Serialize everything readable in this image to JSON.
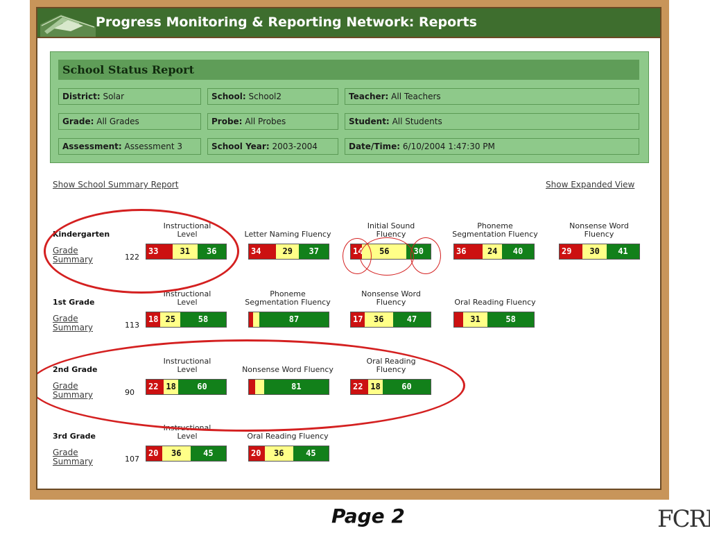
{
  "app_title": "Progress Monitoring & Reporting Network: Reports",
  "report": {
    "title": "School Status Report",
    "fields": {
      "district": {
        "label": "District:",
        "value": "Solar"
      },
      "school": {
        "label": "School:",
        "value": "School2"
      },
      "teacher": {
        "label": "Teacher:",
        "value": "All Teachers"
      },
      "grade": {
        "label": "Grade:",
        "value": "All Grades"
      },
      "probe": {
        "label": "Probe:",
        "value": "All Probes"
      },
      "student": {
        "label": "Student:",
        "value": "All Students"
      },
      "assessment": {
        "label": "Assessment:",
        "value": "Assessment 3"
      },
      "school_year": {
        "label": "School Year:",
        "value": "2003-2004"
      },
      "datetime": {
        "label": "Date/Time:",
        "value": "6/10/2004 1:47:30 PM"
      }
    }
  },
  "links": {
    "school_summary": "Show School Summary Report",
    "expanded_view": "Show Expanded View"
  },
  "grade_summary_label": [
    "Grade",
    "Summary"
  ],
  "grades": [
    {
      "name": "Kindergarten",
      "count": "122",
      "measures": [
        {
          "title": [
            "Instructional",
            "Level"
          ],
          "values": [
            33,
            31,
            36
          ],
          "labels": [
            "33",
            "31",
            "36"
          ]
        },
        {
          "title": [
            "Letter Naming Fluency"
          ],
          "values": [
            34,
            29,
            37
          ],
          "labels": [
            "34",
            "29",
            "37"
          ]
        },
        {
          "title": [
            "Initial Sound",
            "Fluency"
          ],
          "values": [
            14,
            56,
            30
          ],
          "labels": [
            "14",
            "56",
            "30"
          ]
        },
        {
          "title": [
            "Phoneme",
            "Segmentation Fluency"
          ],
          "values": [
            36,
            24,
            40
          ],
          "labels": [
            "36",
            "24",
            "40"
          ]
        },
        {
          "title": [
            "Nonsense Word",
            "Fluency"
          ],
          "values": [
            29,
            30,
            41
          ],
          "labels": [
            "29",
            "30",
            "41"
          ]
        }
      ]
    },
    {
      "name": "1st Grade",
      "count": "113",
      "measures": [
        {
          "title": [
            "Instructional",
            "Level"
          ],
          "values": [
            18,
            25,
            58
          ],
          "labels": [
            "18",
            "25",
            "58"
          ]
        },
        {
          "title": [
            "Phoneme",
            "Segmentation Fluency"
          ],
          "values": [
            5,
            8,
            87
          ],
          "labels": [
            "",
            "",
            "87"
          ]
        },
        {
          "title": [
            "Nonsense Word",
            "Fluency"
          ],
          "values": [
            17,
            36,
            47
          ],
          "labels": [
            "17",
            "36",
            "47"
          ]
        },
        {
          "title": [
            "Oral Reading Fluency"
          ],
          "values": [
            11,
            31,
            58
          ],
          "labels": [
            "",
            "31",
            "58"
          ]
        }
      ]
    },
    {
      "name": "2nd Grade",
      "count": "90",
      "measures": [
        {
          "title": [
            "Instructional",
            "Level"
          ],
          "values": [
            22,
            18,
            60
          ],
          "labels": [
            "22",
            "18",
            "60"
          ]
        },
        {
          "title": [
            "Nonsense Word Fluency"
          ],
          "values": [
            8,
            11,
            81
          ],
          "labels": [
            "",
            "",
            "81"
          ]
        },
        {
          "title": [
            "Oral Reading",
            "Fluency"
          ],
          "values": [
            22,
            18,
            60
          ],
          "labels": [
            "22",
            "18",
            "60"
          ]
        }
      ]
    },
    {
      "name": "3rd Grade",
      "count": "107",
      "measures": [
        {
          "title": [
            "Instructional",
            "Level"
          ],
          "values": [
            20,
            36,
            45
          ],
          "labels": [
            "20",
            "36",
            "45"
          ]
        },
        {
          "title": [
            "Oral Reading Fluency"
          ],
          "values": [
            20,
            36,
            45
          ],
          "labels": [
            "20",
            "36",
            "45"
          ]
        }
      ]
    }
  ],
  "colors": {
    "risk_high": "#cc1111",
    "risk_some": "#ffff88",
    "risk_low": "#12801a",
    "annotation": "#d42020"
  },
  "footer": {
    "page_label": "Page 2",
    "logo_text": "FCRR"
  }
}
